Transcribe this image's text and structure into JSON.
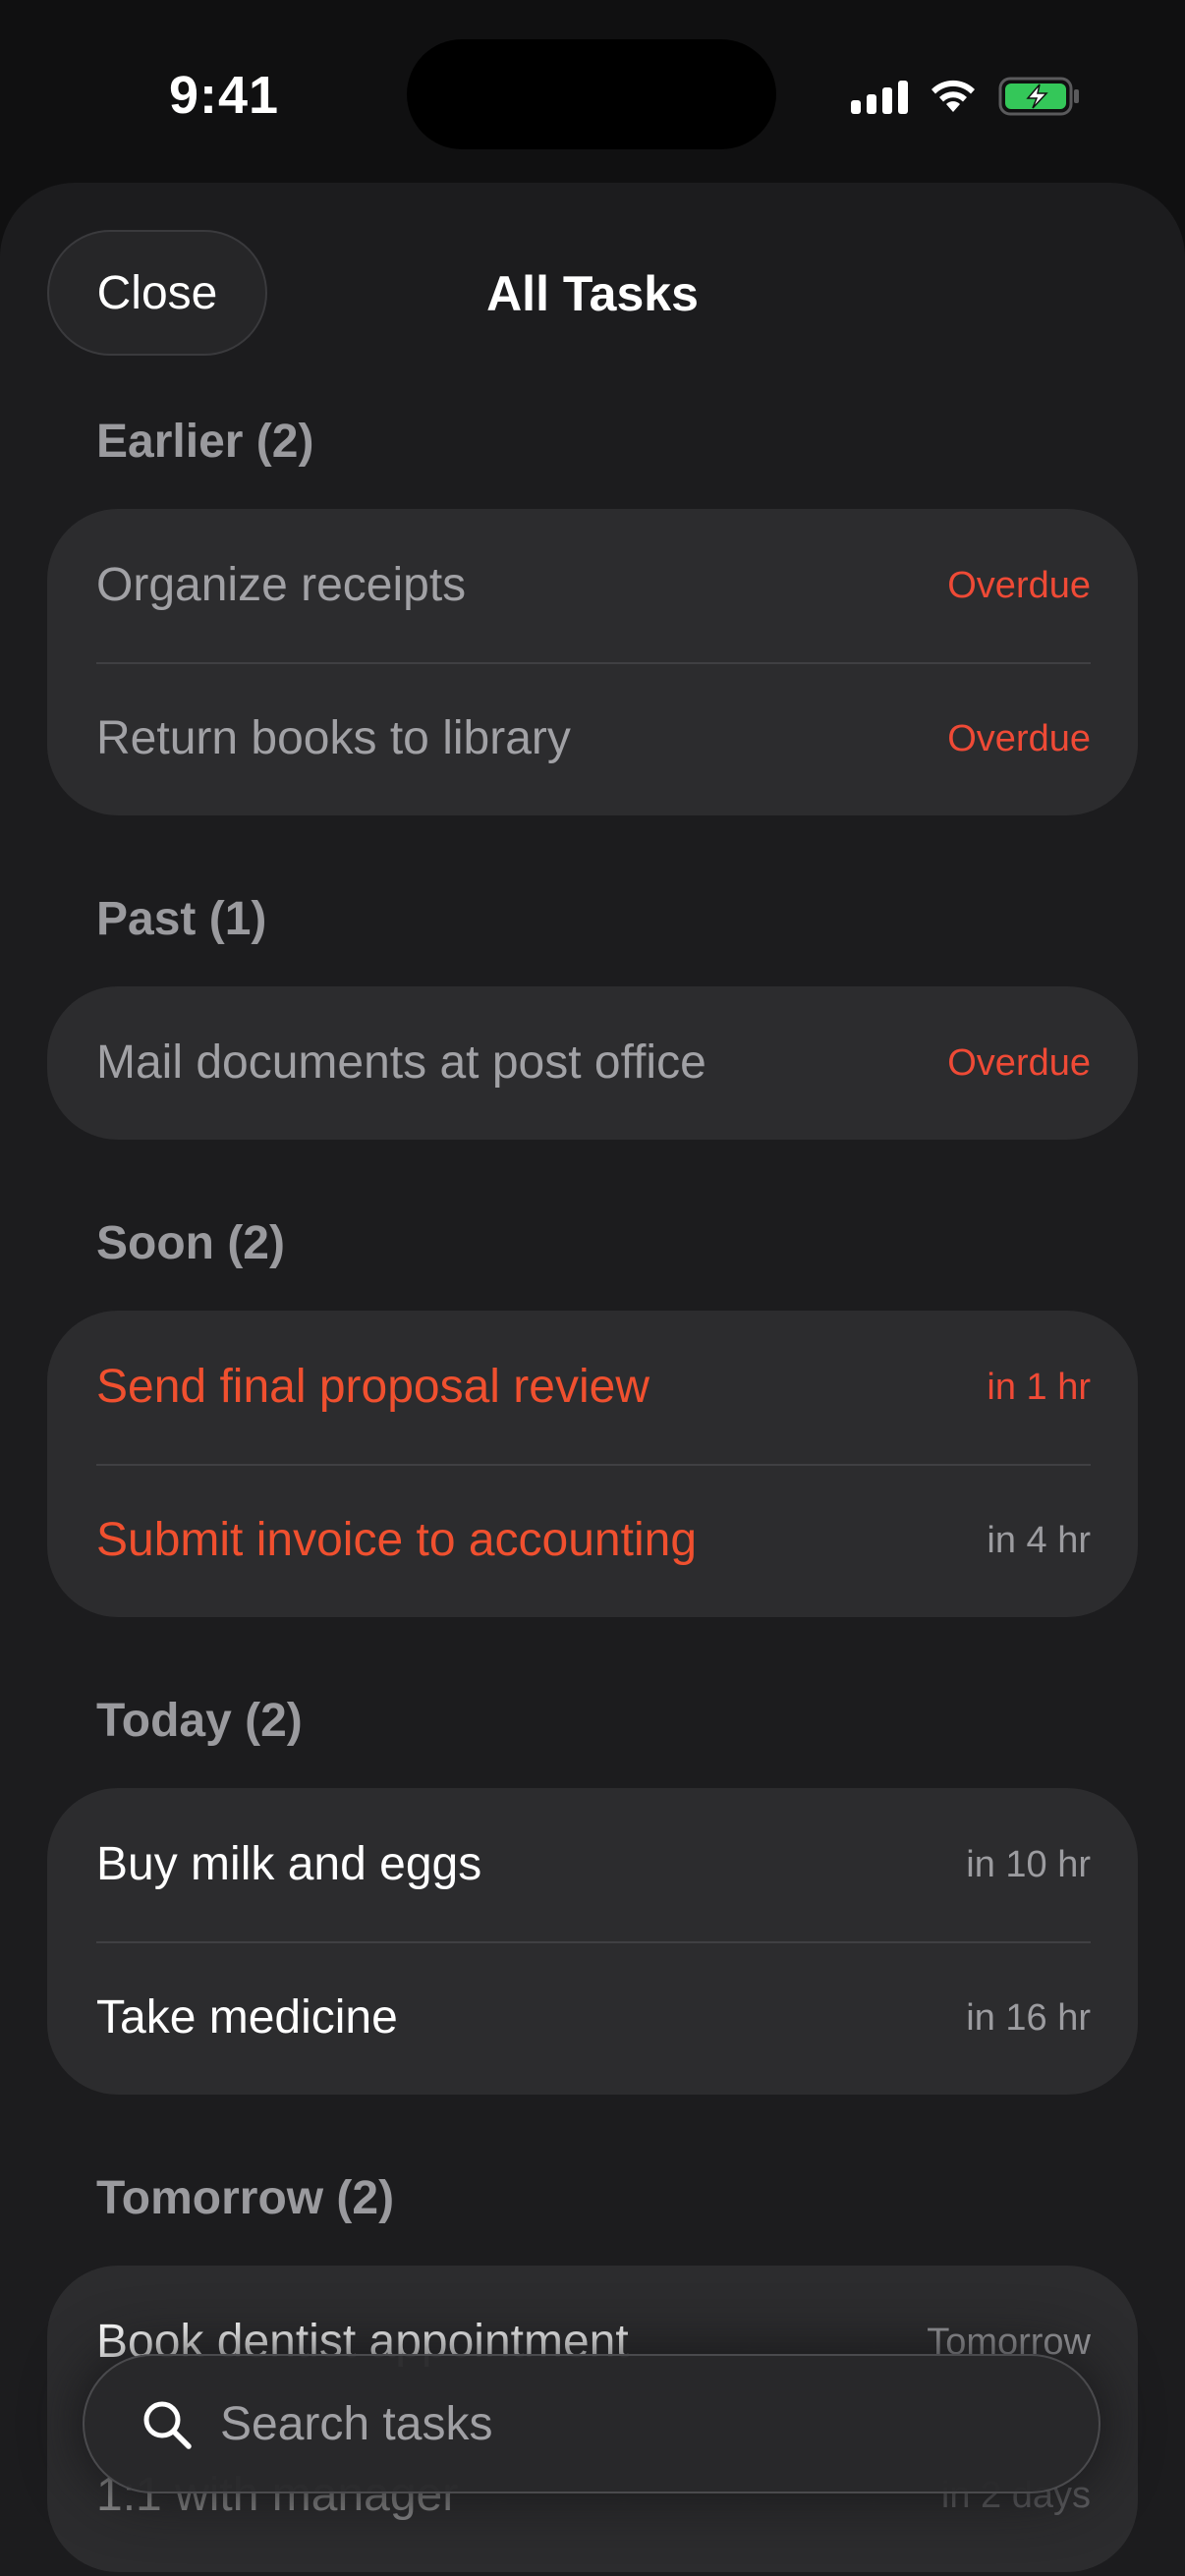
{
  "status_bar": {
    "time": "9:41"
  },
  "sheet": {
    "close_label": "Close",
    "title": "All Tasks"
  },
  "sections": [
    {
      "header": "Earlier (2)",
      "tasks": [
        {
          "title": "Organize receipts",
          "due": "Overdue"
        },
        {
          "title": "Return books to library",
          "due": "Overdue"
        }
      ]
    },
    {
      "header": "Past (1)",
      "tasks": [
        {
          "title": "Mail documents at post office",
          "due": "Overdue"
        }
      ]
    },
    {
      "header": "Soon (2)",
      "tasks": [
        {
          "title": "Send final proposal review",
          "due": "in 1 hr"
        },
        {
          "title": "Submit invoice to accounting",
          "due": "in 4 hr"
        }
      ]
    },
    {
      "header": "Today (2)",
      "tasks": [
        {
          "title": "Buy milk and eggs",
          "due": "in 10 hr"
        },
        {
          "title": "Take medicine",
          "due": "in 16 hr"
        }
      ]
    },
    {
      "header": "Tomorrow (2)",
      "tasks": [
        {
          "title": "Book dentist appointment",
          "due": "Tomorrow"
        },
        {
          "title": "1:1 with manager",
          "due": "in 2 days"
        }
      ]
    }
  ],
  "search": {
    "placeholder": "Search tasks",
    "icon": "search-icon"
  },
  "colors": {
    "accent": "#f0502f",
    "overdue": "#ef4a36",
    "sheet_bg": "#1c1c1e",
    "card_bg": "#2c2c2e",
    "battery": "#34c759"
  }
}
